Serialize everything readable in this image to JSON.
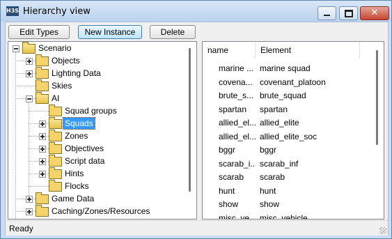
{
  "window": {
    "title": "Hierarchy view",
    "app_icon_text": "H3S",
    "close_glyph": "✕"
  },
  "toolbar": {
    "edit_types_label": "Edit Types",
    "new_instance_label": "New Instance",
    "delete_label": "Delete"
  },
  "tree": {
    "nodes": [
      {
        "label": "Scenario",
        "expander": "minus"
      },
      {
        "label": "Objects",
        "expander": "plus"
      },
      {
        "label": "Lighting Data",
        "expander": "plus"
      },
      {
        "label": "Skies",
        "expander": "none"
      },
      {
        "label": "AI",
        "expander": "minus"
      },
      {
        "label": "Squad groups",
        "expander": "none"
      },
      {
        "label": "Squads",
        "expander": "plus",
        "selected": true
      },
      {
        "label": "Zones",
        "expander": "plus"
      },
      {
        "label": "Objectives",
        "expander": "plus"
      },
      {
        "label": "Script data",
        "expander": "plus"
      },
      {
        "label": "Hints",
        "expander": "plus"
      },
      {
        "label": "Flocks",
        "expander": "none"
      },
      {
        "label": "Game Data",
        "expander": "plus"
      },
      {
        "label": "Caching/Zones/Resources",
        "expander": "plus"
      }
    ]
  },
  "list": {
    "columns": [
      "name",
      "Element"
    ],
    "rows": [
      {
        "name": "marine ...",
        "element": "marine squad"
      },
      {
        "name": "covena...",
        "element": "covenant_platoon"
      },
      {
        "name": "brute_s...",
        "element": "brute_squad"
      },
      {
        "name": "spartan",
        "element": "spartan"
      },
      {
        "name": "allied_el...",
        "element": "allied_elite"
      },
      {
        "name": "allied_el...",
        "element": "allied_elite_soc"
      },
      {
        "name": "bggr",
        "element": "bggr"
      },
      {
        "name": "scarab_i...",
        "element": "scarab_inf"
      },
      {
        "name": "scarab",
        "element": "scarab"
      },
      {
        "name": "hunt",
        "element": "hunt"
      },
      {
        "name": "show",
        "element": "show"
      },
      {
        "name": "misc_ve...",
        "element": "misc_vehicle"
      }
    ]
  },
  "status": {
    "text": "Ready"
  },
  "colors": {
    "selection": "#3399ff",
    "folder": "#f3d36a",
    "title_bar": "#c9dcf1",
    "close_button": "#c54531"
  }
}
